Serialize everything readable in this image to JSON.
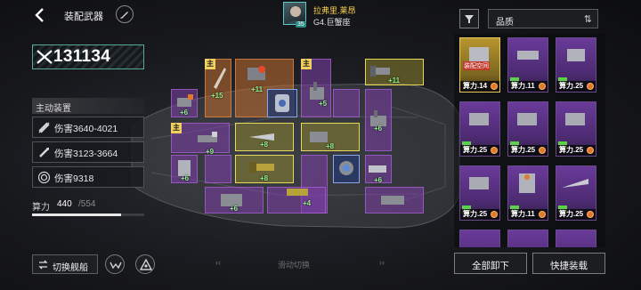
{
  "header": {
    "title": "装配武器"
  },
  "commander": {
    "name": "拉弗里.莱昂",
    "ship": "G4.巨蟹座",
    "level": "35"
  },
  "power": {
    "value": "131134"
  },
  "active_equipment": {
    "title": "主动装置",
    "stats": [
      {
        "icon": "missile-icon",
        "text": "伤害3640-4021"
      },
      {
        "icon": "torpedo-icon",
        "text": "伤害3123-3664"
      },
      {
        "icon": "target-icon",
        "text": "伤害9318"
      }
    ]
  },
  "capacity": {
    "label": "算力",
    "current": "440",
    "max": "/554",
    "fill_fraction": 0.794
  },
  "buttons": {
    "switch_ship": "切换舰船",
    "unequip_all": "全部卸下",
    "quick_equip": "快捷装载"
  },
  "swipe_hint": {
    "left": "‹‹",
    "label": "滑动切换",
    "right": "››"
  },
  "slots": {
    "main_tag": "主",
    "bonuses": [
      "+6",
      "+15",
      "+11",
      "+5",
      "+11",
      "+9",
      "+8",
      "+8",
      "+6",
      "+8",
      "+6",
      "+6",
      "+4",
      "+6"
    ]
  },
  "filter": {
    "sort_label": "品质",
    "sort_icon": "sort-toggle-icon"
  },
  "inventory": [
    {
      "power": "算力.14",
      "rarity": "gold",
      "badge": "装配空间"
    },
    {
      "power": "算力.11",
      "rarity": "purple"
    },
    {
      "power": "算力.25",
      "rarity": "purple"
    },
    {
      "power": "算力.25",
      "rarity": "purple"
    },
    {
      "power": "算力.25",
      "rarity": "purple"
    },
    {
      "power": "算力.25",
      "rarity": "purple"
    },
    {
      "power": "算力.25",
      "rarity": "purple"
    },
    {
      "power": "算力.11",
      "rarity": "purple"
    },
    {
      "power": "算力.25",
      "rarity": "purple"
    }
  ],
  "colors": {
    "accent_teal": "#5aa59c",
    "slot_orange": "#c47030",
    "slot_purple": "#7e40aa",
    "slot_yellow": "#e8d85a",
    "bonus_green": "#8ff08a"
  }
}
